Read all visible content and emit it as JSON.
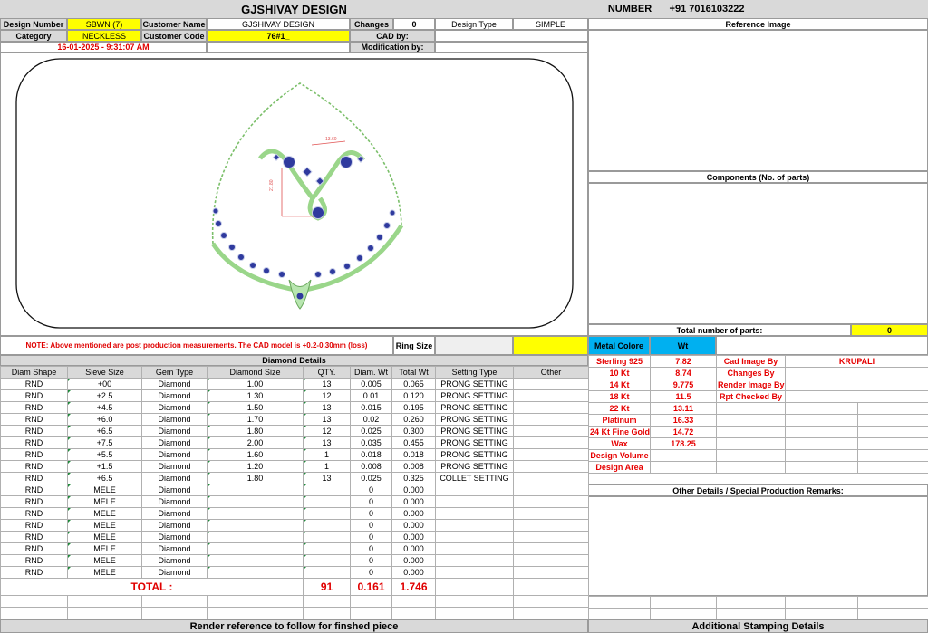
{
  "header": {
    "design_number_label": "Design Number",
    "design_number": "SBWN (7)",
    "company": "GJSHIVAY DESIGN",
    "changes_label": "Changes",
    "changes": "0",
    "design_type_label": "Design Type",
    "design_type": "SIMPLE",
    "phone_label": "NUMBER",
    "phone": "+91 7016103222",
    "category_label": "Category",
    "category": "NECKLESS",
    "customer_name_label": "Customer Name",
    "customer_name": "GJSHIVAY DESIGN",
    "customer_code_label": "Customer Code",
    "customer_code": "76#1_",
    "cad_by_label": "CAD by:",
    "cad_by": "",
    "datetime": "16-01-2025 - 9:31:07 AM",
    "modification_by_label": "Modification by:",
    "modification_by": ""
  },
  "right_panel": {
    "reference_image_title": "Reference Image",
    "components_title": "Components (No. of parts)",
    "total_parts_label": "Total number of parts:",
    "total_parts": "0",
    "metal_color_label": "Metal Colore",
    "wt_label": "Wt",
    "metals": [
      {
        "name": "Sterling 925",
        "wt": "7.82"
      },
      {
        "name": "10 Kt",
        "wt": "8.74"
      },
      {
        "name": "14 Kt",
        "wt": "9.775"
      },
      {
        "name": "18 Kt",
        "wt": "11.5"
      },
      {
        "name": "22 Kt",
        "wt": "13.11"
      },
      {
        "name": "Platinum",
        "wt": "16.33"
      },
      {
        "name": "24 Kt Fine Gold",
        "wt": "14.72"
      },
      {
        "name": "Wax",
        "wt": "178.25"
      },
      {
        "name": "Design Volume",
        "wt": ""
      },
      {
        "name": "Design Area",
        "wt": ""
      }
    ],
    "credits": [
      {
        "label": "Cad Image By",
        "value": "KRUPALI"
      },
      {
        "label": "Changes By",
        "value": ""
      },
      {
        "label": "Render Image By",
        "value": ""
      },
      {
        "label": "Rpt Checked By",
        "value": ""
      }
    ],
    "other_details_title": "Other Details / Special Production Remarks:",
    "additional_stamping_title": "Additional Stamping Details"
  },
  "note": "NOTE: Above mentioned are post production measurements. The CAD model is +0.2-0.30mm (loss)",
  "ring_size_label": "Ring Size",
  "ring_size": "",
  "diamond": {
    "title": "Diamond Details",
    "columns": [
      "Diam Shape",
      "Sieve Size",
      "Gem Type",
      "Diamond Size",
      "QTY.",
      "Diam. Wt",
      "Total Wt",
      "Setting Type",
      "Other"
    ],
    "rows": [
      [
        "RND",
        "+00",
        "Diamond",
        "1.00",
        "13",
        "0.005",
        "0.065",
        "PRONG SETTING",
        ""
      ],
      [
        "RND",
        "+2.5",
        "Diamond",
        "1.30",
        "12",
        "0.01",
        "0.120",
        "PRONG SETTING",
        ""
      ],
      [
        "RND",
        "+4.5",
        "Diamond",
        "1.50",
        "13",
        "0.015",
        "0.195",
        "PRONG SETTING",
        ""
      ],
      [
        "RND",
        "+6.0",
        "Diamond",
        "1.70",
        "13",
        "0.02",
        "0.260",
        "PRONG SETTING",
        ""
      ],
      [
        "RND",
        "+6.5",
        "Diamond",
        "1.80",
        "12",
        "0.025",
        "0.300",
        "PRONG SETTING",
        ""
      ],
      [
        "RND",
        "+7.5",
        "Diamond",
        "2.00",
        "13",
        "0.035",
        "0.455",
        "PRONG SETTING",
        ""
      ],
      [
        "RND",
        "+5.5",
        "Diamond",
        "1.60",
        "1",
        "0.018",
        "0.018",
        "PRONG SETTING",
        ""
      ],
      [
        "RND",
        "+1.5",
        "Diamond",
        "1.20",
        "1",
        "0.008",
        "0.008",
        "PRONG SETTING",
        ""
      ],
      [
        "RND",
        "+6.5",
        "Diamond",
        "1.80",
        "13",
        "0.025",
        "0.325",
        "COLLET SETTING",
        ""
      ],
      [
        "RND",
        "MELE",
        "Diamond",
        "",
        "",
        "0",
        "0.000",
        "",
        ""
      ],
      [
        "RND",
        "MELE",
        "Diamond",
        "",
        "",
        "0",
        "0.000",
        "",
        ""
      ],
      [
        "RND",
        "MELE",
        "Diamond",
        "",
        "",
        "0",
        "0.000",
        "",
        ""
      ],
      [
        "RND",
        "MELE",
        "Diamond",
        "",
        "",
        "0",
        "0.000",
        "",
        ""
      ],
      [
        "RND",
        "MELE",
        "Diamond",
        "",
        "",
        "0",
        "0.000",
        "",
        ""
      ],
      [
        "RND",
        "MELE",
        "Diamond",
        "",
        "",
        "0",
        "0.000",
        "",
        ""
      ],
      [
        "RND",
        "MELE",
        "Diamond",
        "",
        "",
        "0",
        "0.000",
        "",
        ""
      ],
      [
        "RND",
        "MELE",
        "Diamond",
        "",
        "",
        "0",
        "0.000",
        "",
        ""
      ]
    ],
    "total_label": "TOTAL :",
    "total_qty": "91",
    "total_diam_wt": "0.161",
    "total_wt": "1.746"
  },
  "render_reference_title": "Render reference to follow for finshed piece",
  "image_annotations": {
    "dim_width": "13.60",
    "dim_height": "21.80"
  },
  "colors": {
    "yellow": "#ffff00",
    "header_gray": "#d9d9d9",
    "metal_blue": "#00b0f0",
    "red": "#e00000",
    "metal_green": "#b8e6b0"
  }
}
